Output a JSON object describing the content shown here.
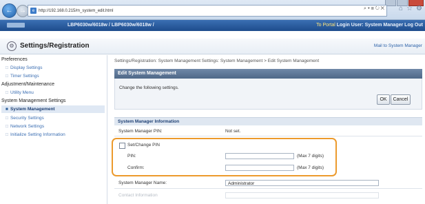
{
  "browser": {
    "url": "http://192.168.0.215/m_system_edit.html",
    "address_tools": "⌕ ▾ ≣ ↻ ✕"
  },
  "device": {
    "model": "LBP6030w/6018w / LBP6030w/6018w /",
    "portal_link": "To Portal",
    "login_user": "Login User: System Manager Log Out"
  },
  "page": {
    "title": "Settings/Registration",
    "mail_link": "Mail to System Manager"
  },
  "sidebar": {
    "groups": [
      {
        "heading": "Preferences",
        "items": [
          "Display Settings",
          "Timer Settings"
        ]
      },
      {
        "heading": "Adjustment/Maintenance",
        "items": [
          "Utility Menu"
        ]
      },
      {
        "heading": "System Management Settings",
        "items": [
          "System Management",
          "Security Settings",
          "Network Settings",
          "Initialize Setting Information"
        ]
      }
    ],
    "selected": "System Management"
  },
  "breadcrumb": "Settings/Registration: System Management Settings: System Management > Edit System Management",
  "panel": {
    "title": "Edit System Management",
    "instruction": "Change the following settings.",
    "ok_label": "OK",
    "cancel_label": "Cancel"
  },
  "section": {
    "title": "System Manager Information",
    "pin_label": "System Manager PIN:",
    "pin_value": "Not set.",
    "set_change_label": "Set/Change PIN",
    "pin_field_label": "PIN:",
    "pin_hint": "(Max 7 digits)",
    "confirm_label": "Confirm:",
    "confirm_hint": "(Max 7 digits)",
    "name_label": "System Manager Name:",
    "name_value": "Administrator",
    "contact_label": "Contact Information"
  },
  "colors": {
    "accent": "#1e4c8c",
    "highlight": "#ec9a2c",
    "link": "#3b6eb2"
  }
}
